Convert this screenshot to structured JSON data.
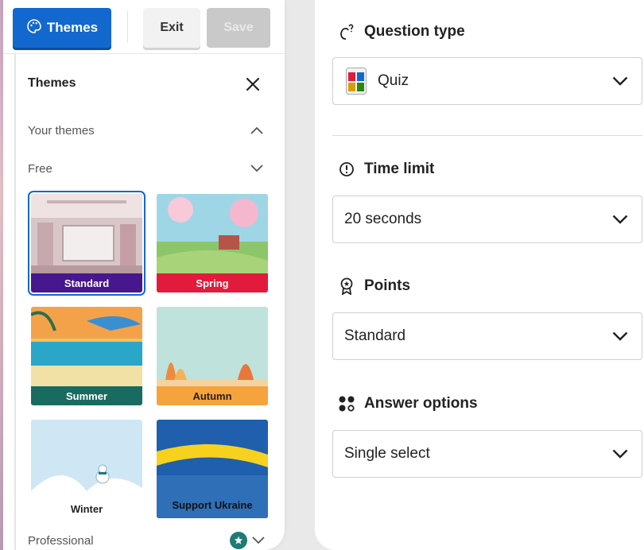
{
  "toolbar": {
    "themes_label": "Themes",
    "exit_label": "Exit",
    "save_label": "Save"
  },
  "themes_panel": {
    "title": "Themes",
    "sections": {
      "your_themes": "Your themes",
      "free": "Free",
      "professional": "Professional"
    },
    "tiles": [
      {
        "label": "Standard",
        "color": "#46178f"
      },
      {
        "label": "Spring",
        "color": "#e21b3c"
      },
      {
        "label": "Summer",
        "color": "#1a6b5f"
      },
      {
        "label": "Autumn",
        "color": "#f5a33c"
      },
      {
        "label": "Winter",
        "color": "#ffffff"
      },
      {
        "label": "Support Ukraine",
        "color": "#2f6fb7"
      }
    ]
  },
  "settings": {
    "question_type": {
      "title": "Question type",
      "value": "Quiz"
    },
    "time_limit": {
      "title": "Time limit",
      "value": "20 seconds"
    },
    "points": {
      "title": "Points",
      "value": "Standard"
    },
    "answer_options": {
      "title": "Answer options",
      "value": "Single select"
    }
  },
  "colors": {
    "brand_blue": "#1368ce",
    "save_disabled": "#c9c9c9"
  }
}
